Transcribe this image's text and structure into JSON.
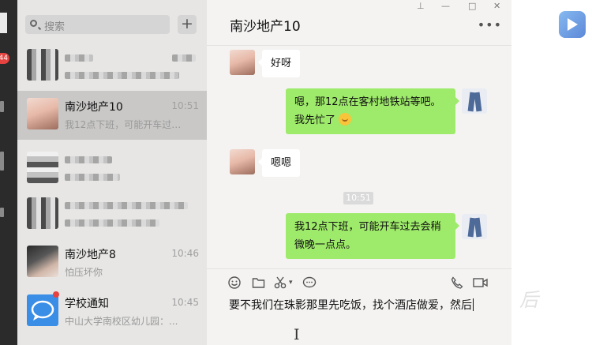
{
  "window": {
    "pin_icon": "pin-icon",
    "minimize": "—",
    "maximize": "□",
    "close": "✕"
  },
  "sidebar": {
    "badge": "44"
  },
  "search": {
    "placeholder": "搜索",
    "add_label": "+"
  },
  "conversations": [
    {
      "name": "",
      "time": "",
      "preview": "",
      "avatar": "blurred"
    },
    {
      "name": "南沙地产10",
      "time": "10:51",
      "preview": "我12点下班，可能开车过去...",
      "avatar": "photo-woman",
      "active": true
    },
    {
      "name": "",
      "time": "",
      "preview": "",
      "avatar": "blurred"
    },
    {
      "name": "",
      "time": "",
      "preview": "",
      "avatar": "blurred"
    },
    {
      "name": "南沙地产8",
      "time": "10:46",
      "preview": "怕压坏你",
      "avatar": "photo-woman-dark"
    },
    {
      "name": "学校通知",
      "time": "10:45",
      "preview": "中山大学南校区幼儿园：...",
      "avatar": "chat-bubble-icon",
      "has_dot": true
    }
  ],
  "chat": {
    "title": "南沙地产10",
    "more_label": "•••",
    "messages": [
      {
        "side": "in",
        "lines": [
          "好呀"
        ]
      },
      {
        "side": "out",
        "lines": [
          "嗯，那12点在客村地铁站等吧。",
          "我先忙了"
        ],
        "emoji": "smile-emoji-icon"
      },
      {
        "side": "in",
        "lines": [
          "嗯嗯"
        ]
      },
      {
        "side": "time",
        "text": "10:51"
      },
      {
        "side": "out",
        "lines": [
          "我12点下班，可能开车过去会稍",
          "微晚一点点。"
        ]
      }
    ],
    "toolbar": [
      "emoji-icon",
      "folder-icon",
      "scissors-icon",
      "chat-history-icon",
      "phone-icon",
      "video-call-icon"
    ],
    "input_value": "要不我们在珠影那里先吃饭，找个酒店做爱，然后"
  },
  "colors": {
    "out_bubble": "#9eea6a",
    "list_bg": "#e7e6e5",
    "chat_bg": "#f4f3f2",
    "badge": "#e64340"
  }
}
